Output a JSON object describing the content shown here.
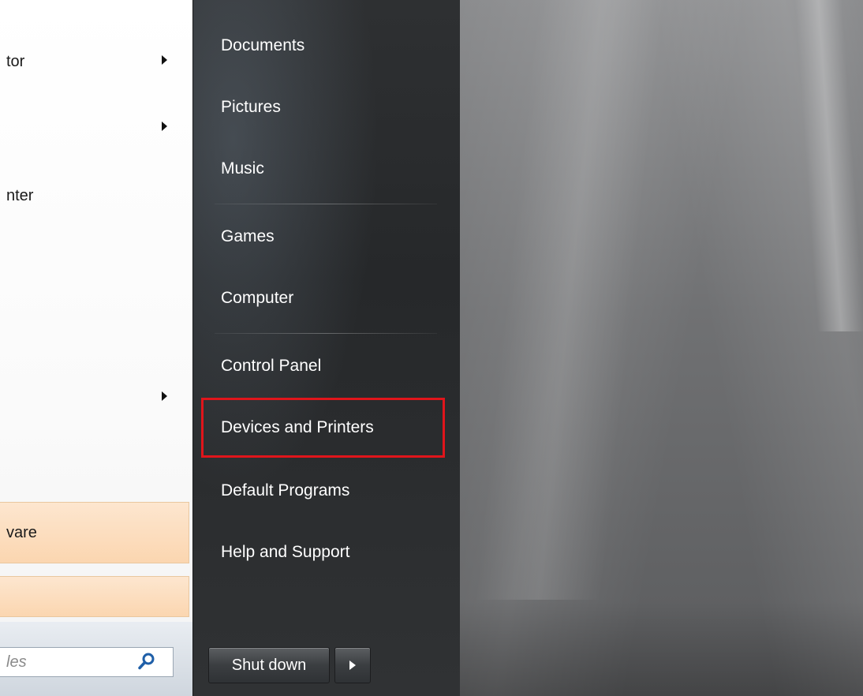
{
  "left_pane": {
    "items": [
      {
        "label": "tor",
        "has_arrow": true
      },
      {
        "label": "",
        "has_arrow": true
      },
      {
        "label": "nter",
        "has_arrow": false
      },
      {
        "label": "",
        "has_arrow": true
      }
    ],
    "highlighted": [
      {
        "label": "vare"
      },
      {
        "label": ""
      }
    ],
    "search": {
      "placeholder": "les",
      "icon": "search-icon"
    }
  },
  "right_pane": {
    "items": [
      {
        "label": "Documents"
      },
      {
        "label": "Pictures"
      },
      {
        "label": "Music"
      },
      {
        "label": "Games"
      },
      {
        "label": "Computer"
      },
      {
        "label": "Control Panel"
      },
      {
        "label": "Devices and Printers"
      },
      {
        "label": "Default Programs"
      },
      {
        "label": "Help and Support"
      }
    ],
    "highlight_color": "#e0151b"
  },
  "shutdown": {
    "label": "Shut down",
    "arrow_icon": "play-arrow-icon"
  }
}
